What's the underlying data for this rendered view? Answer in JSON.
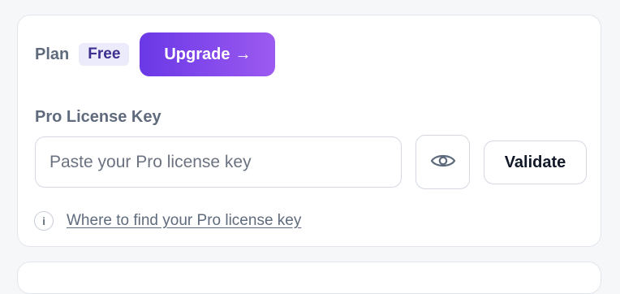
{
  "plan": {
    "label": "Plan",
    "badge": "Free",
    "upgrade_label": "Upgrade",
    "upgrade_arrow": "→"
  },
  "license": {
    "label": "Pro License Key",
    "placeholder": "Paste your Pro license key",
    "value": "",
    "toggle_icon": "eye-icon",
    "validate_label": "Validate"
  },
  "help": {
    "icon": "info-icon",
    "info_glyph": "i",
    "link_text": "Where to find your Pro license key"
  },
  "colors": {
    "accent_start": "#6a38e6",
    "accent_end": "#9c5af0",
    "badge_bg": "#ecebfb",
    "badge_text": "#3b2f8f",
    "muted_text": "#5f6b7c",
    "border": "#d4d9e1"
  }
}
